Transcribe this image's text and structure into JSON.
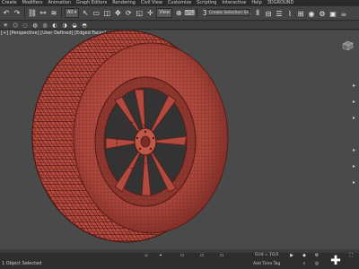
{
  "menu": [
    "Create",
    "Modifiers",
    "Animation",
    "Graph Editors",
    "Rendering",
    "Civil View",
    "Customize",
    "Scripting",
    "Interactive",
    "Help",
    "3DGROUND"
  ],
  "toolbar": {
    "icons": [
      "undo-icon",
      "redo-icon",
      "link-icon",
      "unlink-icon",
      "bind-icon",
      "select-icon",
      "select-region-icon",
      "window-crossing-icon",
      "move-icon",
      "rotate-icon",
      "scale-icon",
      "pivot-icon",
      "snaps-toggle-icon",
      "angle-snap-icon",
      "percent-snap-icon",
      "mirror-icon",
      "align-icon",
      "layer-icon",
      "graph-icon",
      "material-icon",
      "render-icon"
    ],
    "view_dropdown": "View",
    "create_selection_set": "Create Selection Set"
  },
  "viewport": {
    "label": "[+] [Perspective] [User Defined] [Edged Faces]"
  },
  "status": {
    "selected": "1 Object Selected",
    "grid": "Grid = 10,0",
    "add_time_tag": "Add Time Tag"
  },
  "colors": {
    "tire": "#b5473c",
    "wire": "#7a2a22",
    "background": "#4a4a4a"
  }
}
